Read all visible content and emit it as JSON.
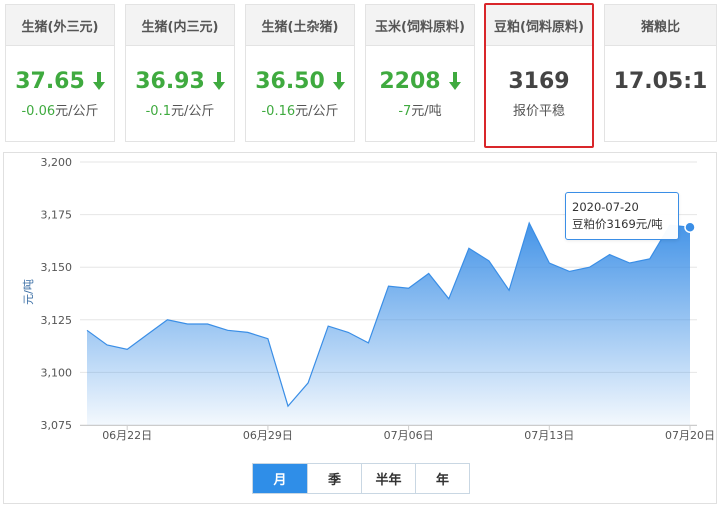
{
  "cards": [
    {
      "title": "生猪(外三元)",
      "value": "37.65",
      "trend": "down",
      "change": "-0.06",
      "unit": "元/公斤"
    },
    {
      "title": "生猪(内三元)",
      "value": "36.93",
      "trend": "down",
      "change": "-0.1",
      "unit": "元/公斤"
    },
    {
      "title": "生猪(土杂猪)",
      "value": "36.50",
      "trend": "down",
      "change": "-0.16",
      "unit": "元/公斤"
    },
    {
      "title": "玉米(饲料原料)",
      "value": "2208",
      "trend": "down",
      "change": "-7",
      "unit": "元/吨"
    },
    {
      "title": "豆粕(饲料原料)",
      "value": "3169",
      "trend": "flat",
      "change": "报价平稳",
      "unit": ""
    },
    {
      "title": "猪粮比",
      "value": "17.05:1",
      "trend": "none",
      "change": "",
      "unit": ""
    }
  ],
  "colors": {
    "down": "#3faa3f",
    "highlight_border": "#d9262a",
    "series": "#3a8ee6",
    "active_tab": "#2f8ee8"
  },
  "chart_data": {
    "type": "area",
    "ylabel": "元/吨",
    "ylim": [
      3075,
      3200
    ],
    "yticks": [
      3075,
      3100,
      3125,
      3150,
      3175,
      3200
    ],
    "ytick_labels": [
      "3,075",
      "3,100",
      "3,125",
      "3,150",
      "3,175",
      "3,200"
    ],
    "x": [
      "06-20",
      "06-21",
      "06-22",
      "06-23",
      "06-24",
      "06-25",
      "06-26",
      "06-27",
      "06-28",
      "06-29",
      "06-30",
      "07-01",
      "07-02",
      "07-03",
      "07-04",
      "07-05",
      "07-06",
      "07-07",
      "07-08",
      "07-09",
      "07-10",
      "07-11",
      "07-12",
      "07-13",
      "07-14",
      "07-15",
      "07-16",
      "07-17",
      "07-18",
      "07-19",
      "07-20"
    ],
    "values": [
      3120,
      3113,
      3111,
      3118,
      3125,
      3123,
      3123,
      3120,
      3119,
      3116,
      3084,
      3095,
      3122,
      3119,
      3114,
      3141,
      3140,
      3147,
      3135,
      3159,
      3153,
      3139,
      3171,
      3152,
      3148,
      3150,
      3156,
      3152,
      3154,
      3170,
      3169
    ],
    "xtick_labels": [
      {
        "index": 2,
        "label": "06月22日"
      },
      {
        "index": 9,
        "label": "06月29日"
      },
      {
        "index": 16,
        "label": "07月06日"
      },
      {
        "index": 23,
        "label": "07月13日"
      },
      {
        "index": 30,
        "label": "07月20日"
      }
    ],
    "grid": true,
    "tooltip": {
      "date": "2020-07-20",
      "text": "豆粕价3169元/吨"
    }
  },
  "range_tabs": [
    "月",
    "季",
    "半年",
    "年"
  ],
  "active_range": "月"
}
